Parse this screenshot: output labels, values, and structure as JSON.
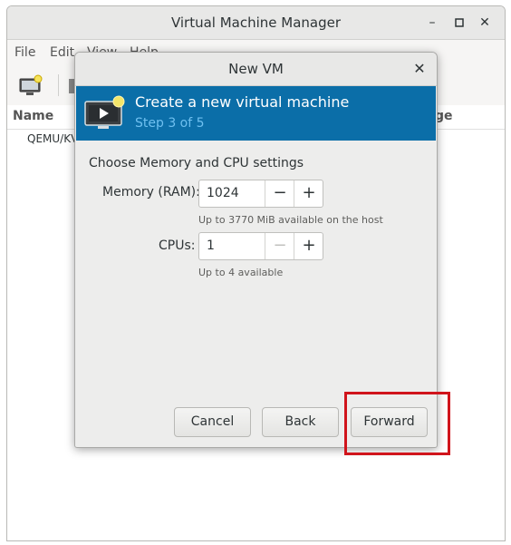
{
  "main_window": {
    "title": "Virtual Machine Manager",
    "menu": [
      "File",
      "Edit",
      "View",
      "Help"
    ],
    "columns": {
      "name": "Name",
      "usage": "ge"
    },
    "connection": "QEMU/KV"
  },
  "dialog": {
    "title": "New VM",
    "banner": {
      "title": "Create a new virtual machine",
      "step": "Step 3 of 5"
    },
    "section": "Choose Memory and CPU settings",
    "memory": {
      "label": "Memory (RAM):",
      "value": "1024",
      "hint": "Up to 3770 MiB available on the host"
    },
    "cpus": {
      "label": "CPUs:",
      "value": "1",
      "hint": "Up to 4 available"
    },
    "buttons": {
      "cancel": "Cancel",
      "back": "Back",
      "forward": "Forward"
    }
  },
  "colors": {
    "banner": "#0b6ea8",
    "step_text": "#6fc0f0",
    "highlight": "#d0141b"
  }
}
